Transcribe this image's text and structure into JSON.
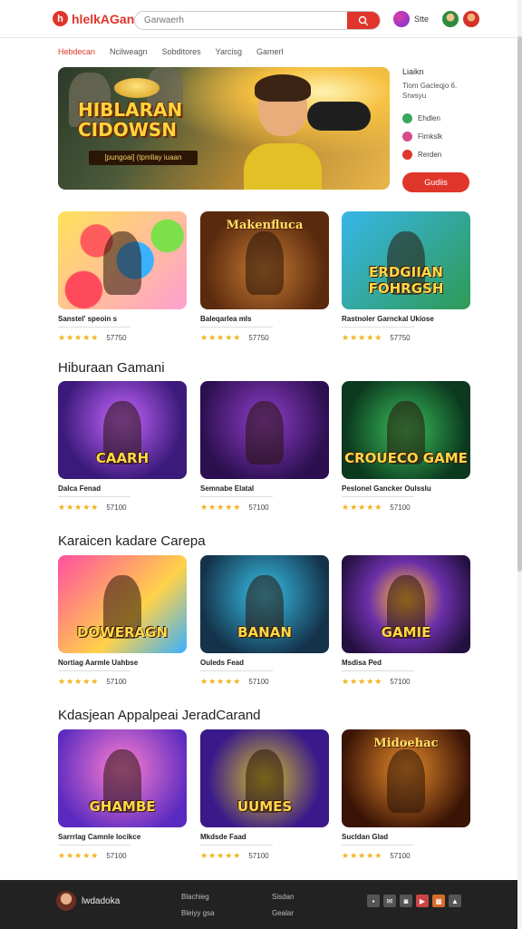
{
  "header": {
    "logo_mark": "h",
    "logo_text": "hlelkAGan",
    "search_placeholder": "Garwaerh",
    "badge_label": "Stte"
  },
  "nav": [
    "Hebdecan",
    "Ncilweagn",
    "Sobditores",
    "Yarcisg",
    "Gamerl"
  ],
  "hero": {
    "title": "HIBLARAN CIDOWSN",
    "subtitle": "[pungoai] (tpmllay iuaan"
  },
  "side": {
    "title": "Liaikn",
    "description": "Tiom Gacleqjo 6. Srwsyu",
    "items": [
      {
        "label": "Ehdlen",
        "color": "#3ba55c"
      },
      {
        "label": "Fimkslk",
        "color": "#d94b8a"
      },
      {
        "label": "Rerden",
        "color": "#e0352b"
      }
    ],
    "button": "Gudiis"
  },
  "sections": [
    {
      "title": "",
      "cards": [
        {
          "title": "Sanstel' speoin s",
          "art": "",
          "art_top": "",
          "rating": "★★★★★",
          "count": "57750"
        },
        {
          "title": "Baleqarlea mls",
          "art": "",
          "art_top": "Makenfluca",
          "rating": "★★★★★",
          "count": "57750"
        },
        {
          "title": "Rastnoler Garnckal Ukiose",
          "art": "ERDGIIAN FOHRGSH",
          "art_top": "",
          "rating": "★★★★★",
          "count": "57750"
        }
      ]
    },
    {
      "title": "Hiburaan Gamani",
      "cards": [
        {
          "title": "Dalca Fenad",
          "art": "CAARH",
          "art_top": "",
          "rating": "★★★★★",
          "count": "57100"
        },
        {
          "title": "Semnabe Elatal",
          "art": "",
          "art_top": "",
          "rating": "★★★★★",
          "count": "57100"
        },
        {
          "title": "Peslonel Gancker Oulsslu",
          "art": "CROUECO GAME",
          "art_top": "",
          "rating": "★★★★★",
          "count": "57100"
        }
      ]
    },
    {
      "title": "Karaicen kadare Carepa",
      "cards": [
        {
          "title": "Nortiag Aarmle Uahbse",
          "art": "DOWERAGN",
          "art_top": "",
          "rating": "★★★★★",
          "count": "57100"
        },
        {
          "title": "Ouleds Fead",
          "art": "BANAN",
          "art_top": "",
          "rating": "★★★★★",
          "count": "57100"
        },
        {
          "title": "Msdisa Ped",
          "art": "GAMIE",
          "art_top": "",
          "rating": "★★★★★",
          "count": "57100"
        }
      ]
    },
    {
      "title": "Kdasjean Appalpeai JeradCarand",
      "cards": [
        {
          "title": "Sarrrlag Camnle Iocikce",
          "art": "GHAMBE",
          "art_top": "",
          "rating": "★★★★★",
          "count": "57100"
        },
        {
          "title": "Mkdsde Faad",
          "art": "UUMES",
          "art_top": "",
          "rating": "★★★★★",
          "count": "57100"
        },
        {
          "title": "Sucldan Glad",
          "art": "",
          "art_top": "Midoehac",
          "rating": "★★★★★",
          "count": "57100"
        }
      ]
    }
  ],
  "footer": {
    "logo_text": "lwdadoka",
    "col1": [
      "Blachieg",
      "Bleiyy gsa"
    ],
    "col2": [
      "Sisdan",
      "Gealar"
    ]
  },
  "colors": {
    "accent": "#e0352b",
    "star": "#f3b21b",
    "footer_bg": "#222222"
  }
}
